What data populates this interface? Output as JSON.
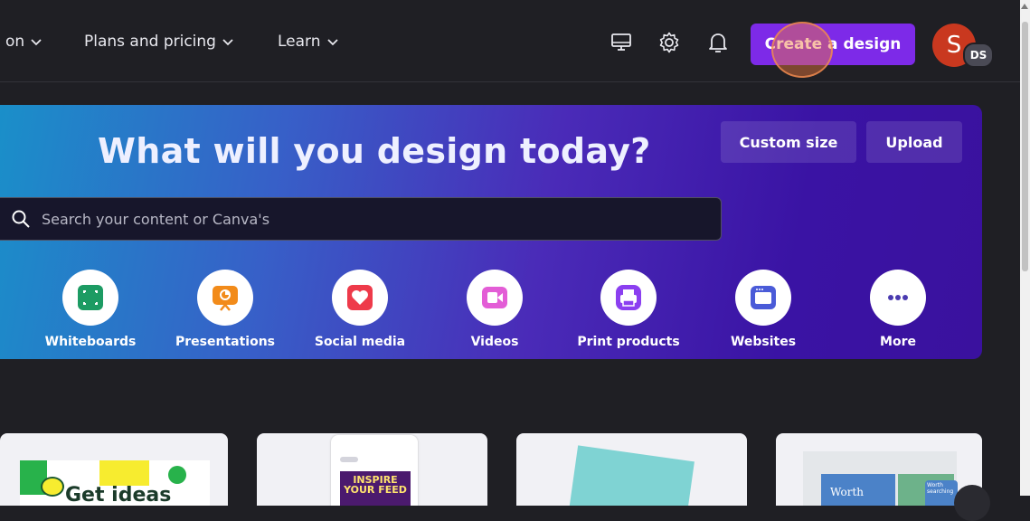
{
  "nav": {
    "items": [
      {
        "label": "on"
      },
      {
        "label": "Plans and pricing"
      },
      {
        "label": "Learn"
      }
    ],
    "create_label": "Create a design",
    "avatar_initial": "S",
    "avatar_badge": "DS"
  },
  "hero": {
    "title": "What will you design today?",
    "custom_size_label": "Custom size",
    "upload_label": "Upload",
    "search_placeholder": "Search your content or Canva's"
  },
  "categories": [
    {
      "label": "Whiteboards"
    },
    {
      "label": "Presentations"
    },
    {
      "label": "Social media"
    },
    {
      "label": "Videos"
    },
    {
      "label": "Print products"
    },
    {
      "label": "Websites"
    },
    {
      "label": "More"
    }
  ],
  "cards": {
    "card1_text": "Get ideas",
    "card2_text_line1": "INSPIRE",
    "card2_text_line2": "YOUR FEED",
    "card4_text": "Worth",
    "card4_small": "Worth searching"
  },
  "colors": {
    "accent": "#7d2ae8",
    "hero_start": "#1a8fc9",
    "hero_end": "#3a119e"
  }
}
